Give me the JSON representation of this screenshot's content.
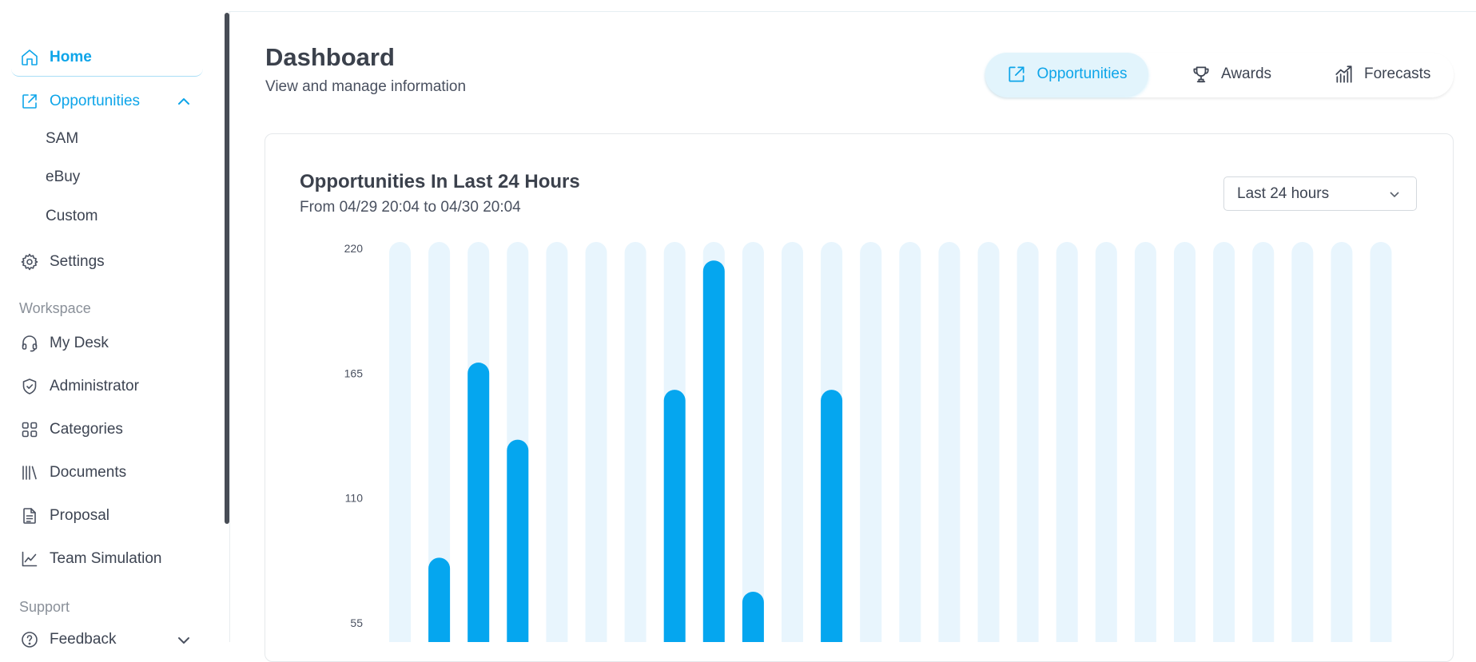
{
  "sidebar": {
    "home": "Home",
    "opportunities": "Opportunities",
    "sub_items": [
      "SAM",
      "eBuy",
      "Custom"
    ],
    "settings": "Settings",
    "workspace_header": "Workspace",
    "workspace_items": [
      "My Desk",
      "Administrator",
      "Categories",
      "Documents",
      "Proposal",
      "Team Simulation"
    ],
    "support_header": "Support",
    "feedback": "Feedback"
  },
  "header": {
    "title": "Dashboard",
    "subtitle": "View and manage information",
    "tabs": [
      "Opportunities",
      "Awards",
      "Forecasts"
    ],
    "active_tab": "Opportunities"
  },
  "card": {
    "title": "Opportunities In Last 24 Hours",
    "subtitle": "From 04/29 20:04 to 04/30 20:04",
    "range_select": "Last 24 hours"
  },
  "colors": {
    "accent": "#0ea5e9",
    "bar_track": "#e8f5fd",
    "bar_fill": "#05a6ef"
  },
  "chart_data": {
    "type": "bar",
    "title": "Opportunities In Last 24 Hours",
    "ylim": [
      0,
      220
    ],
    "yticks": [
      220,
      165,
      110,
      55
    ],
    "values": [
      0,
      84,
      170,
      136,
      2,
      0,
      0,
      158,
      215,
      69,
      0,
      158,
      0,
      0,
      0,
      0,
      0,
      0,
      0,
      0,
      0,
      0,
      0,
      0,
      0,
      0
    ],
    "grid": false,
    "legend": "none"
  }
}
